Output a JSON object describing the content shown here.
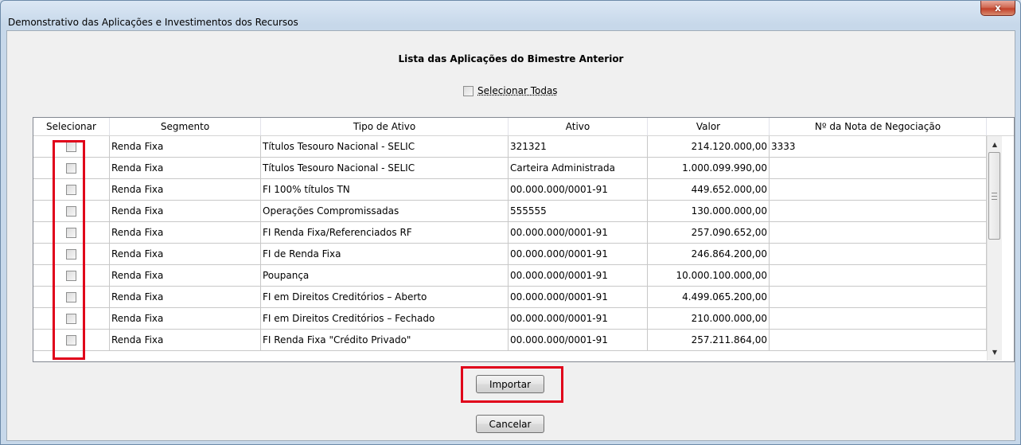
{
  "window": {
    "title": "Demonstrativo das Aplicações e Investimentos dos Recursos",
    "close_label": "x"
  },
  "list_title": "Lista das Aplicações do Bimestre Anterior",
  "select_all_label": "Selecionar Todas",
  "table": {
    "columns": [
      "Selecionar",
      "Segmento",
      "Tipo de Ativo",
      "Ativo",
      "Valor",
      "Nº da Nota de Negociação"
    ],
    "rows": [
      {
        "segmento": "Renda Fixa",
        "tipo": "Títulos Tesouro Nacional - SELIC",
        "ativo": "321321",
        "valor": "214.120.000,00",
        "nota": "3333"
      },
      {
        "segmento": "Renda Fixa",
        "tipo": "Títulos Tesouro Nacional - SELIC",
        "ativo": "Carteira Administrada",
        "valor": "1.000.099.990,00",
        "nota": ""
      },
      {
        "segmento": "Renda Fixa",
        "tipo": "FI 100% títulos TN",
        "ativo": "00.000.000/0001-91",
        "valor": "449.652.000,00",
        "nota": ""
      },
      {
        "segmento": "Renda Fixa",
        "tipo": "Operações Compromissadas",
        "ativo": "555555",
        "valor": "130.000.000,00",
        "nota": ""
      },
      {
        "segmento": "Renda Fixa",
        "tipo": "FI Renda Fixa/Referenciados RF",
        "ativo": "00.000.000/0001-91",
        "valor": "257.090.652,00",
        "nota": ""
      },
      {
        "segmento": "Renda Fixa",
        "tipo": "FI de Renda Fixa",
        "ativo": "00.000.000/0001-91",
        "valor": "246.864.200,00",
        "nota": ""
      },
      {
        "segmento": "Renda Fixa",
        "tipo": "Poupança",
        "ativo": "00.000.000/0001-91",
        "valor": "10.000.100.000,00",
        "nota": ""
      },
      {
        "segmento": "Renda Fixa",
        "tipo": "FI em Direitos Creditórios – Aberto",
        "ativo": "00.000.000/0001-91",
        "valor": "4.499.065.200,00",
        "nota": ""
      },
      {
        "segmento": "Renda Fixa",
        "tipo": "FI em Direitos Creditórios – Fechado",
        "ativo": "00.000.000/0001-91",
        "valor": "210.000.000,00",
        "nota": ""
      },
      {
        "segmento": "Renda Fixa",
        "tipo": "FI Renda Fixa \"Crédito Privado\"",
        "ativo": "00.000.000/0001-91",
        "valor": "257.211.864,00",
        "nota": ""
      }
    ]
  },
  "buttons": {
    "import_label": "Importar",
    "cancel_label": "Cancelar"
  },
  "colors": {
    "highlight": "#e0001a",
    "close_button": "#c2412a"
  }
}
